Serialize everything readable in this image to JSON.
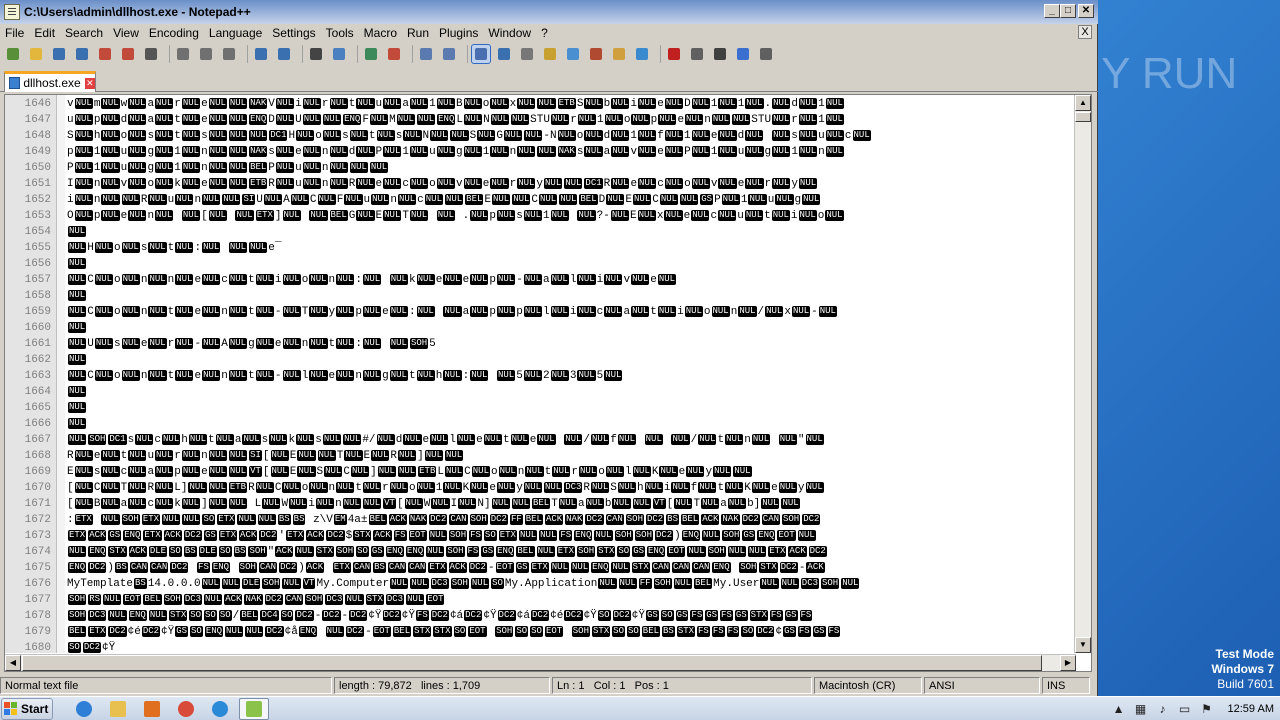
{
  "window": {
    "title": "C:\\Users\\admin\\dllhost.exe - Notepad++",
    "min_label": "_",
    "max_label": "□",
    "close_label": "✕"
  },
  "menu": [
    "File",
    "Edit",
    "Search",
    "View",
    "Encoding",
    "Language",
    "Settings",
    "Tools",
    "Macro",
    "Run",
    "Plugins",
    "Window",
    "?"
  ],
  "menu_close": "X",
  "toolbar_icons": [
    "new-file-icon",
    "open-file-icon",
    "save-icon",
    "save-all-icon",
    "close-icon",
    "close-all-icon",
    "print-icon",
    "cut-icon",
    "copy-icon",
    "paste-icon",
    "undo-icon",
    "redo-icon",
    "find-icon",
    "replace-icon",
    "zoom-in-icon",
    "zoom-out-icon",
    "sync-vertical-icon",
    "sync-horizontal-icon",
    "word-wrap-icon",
    "show-all-chars-icon",
    "indent-guide-icon",
    "user-language-icon",
    "doc-map-icon",
    "function-list-icon",
    "folder-workspace-icon",
    "monitoring-icon",
    "record-macro-icon",
    "stop-record-icon",
    "play-macro-icon",
    "run-macro-multiple-icon",
    "save-macro-icon"
  ],
  "tab": {
    "label": "dllhost.exe"
  },
  "editor": {
    "lines": [
      {
        "n": "1646",
        "t": "vNULmNULwNULaNULrNULeNULNULNAKVNULiNULrNULtNULuNULaNUL1NULBNULoNULxNULNULETBSNULbNULiNULeNULDNUL1NUL1NUL.NULdNUL1NUL"
      },
      {
        "n": "1647",
        "t": "uNULpNULdNULaNULtNULeNULNULENQDNULUNULNULENQFNULMNULNULENQLNULNNULNULSTUNULrNUL1NULoNULpNULeNULnNULNULSTUNULrNUL1NUL"
      },
      {
        "n": "1648",
        "t": "SNULhNULoNULsNULtNULsNULNULNULDC1HNULoNULsNULtNULsNULNNULNULSNULGNULNUL-NNULoNULdNUL1NULfNUL1NULeNULdNUL NULsNULuNULcNUL"
      },
      {
        "n": "1649",
        "t": "pNUL1NULuNULgNUL1NULnNULNULNAKsNULeNULnNULdNULPNUL1NULuNULgNUL1NULnNULNULNAKsNULaNULvNULeNULPNUL1NULuNULgNUL1NULnNUL"
      },
      {
        "n": "1650",
        "t": "PNUL1NULuNULgNUL1NULnNULNULBELPNULuNULnNULNULNUL"
      },
      {
        "n": "1651",
        "t": "INULnNULvNULoNULkNULeNULNULETBRNULuNULnNULRNULeNULcNULoNULvNULeNULrNULyNULNULDC1RNULeNULcNULoNULvNULeNULrNULyNUL"
      },
      {
        "n": "1652",
        "t": "iNULnNULNULRNULuNULnNULNULSIUNULANULCNULFNULuNULnNULcNULNULBELENULNULCNULNULBELDNULENULCNULNULGSPNUL1NULuNULgNUL"
      },
      {
        "n": "1653",
        "t": "ONULpNULeNULnNUL NUL[NUL NULETX]NUL NULBELGNULENULTNUL NUL    .NULpNULsNUL1NUL NUL?-NULENULxNULeNULcNULuNULtNULiNULoNUL"
      },
      {
        "n": "1654",
        "t": "NUL"
      },
      {
        "n": "1655",
        "t": "NULHNULoNULsNULtNUL:NUL NULNULe¯"
      },
      {
        "n": "1656",
        "t": "NUL"
      },
      {
        "n": "1657",
        "t": "NULCNULoNULnNULnNULeNULcNULtNULiNULoNULnNUL:NUL NULkNULeNULeNULpNUL-NULaNULlNULiNULvNULeNUL"
      },
      {
        "n": "1658",
        "t": "NUL"
      },
      {
        "n": "1659",
        "t": "NULCNULoNULnNULtNULeNULnNULtNUL-NULTNULyNULpNULeNUL:NUL NULaNULpNULpNULlNULiNULcNULaNULtNULiNULoNULnNUL/NULxNUL-NUL"
      },
      {
        "n": "1660",
        "t": "NUL"
      },
      {
        "n": "1661",
        "t": "NULUNULsNULeNULrNUL-NULANULgNULeNULnNULtNUL:NUL NULSOH5"
      },
      {
        "n": "1662",
        "t": "NUL"
      },
      {
        "n": "1663",
        "t": "NULCNULoNULnNULtNULeNULnNULtNUL-NULlNULeNULnNULgNULtNULhNUL:NUL NUL5NUL2NUL3NUL5NUL"
      },
      {
        "n": "1664",
        "t": "NUL"
      },
      {
        "n": "1665",
        "t": "NUL"
      },
      {
        "n": "1666",
        "t": "NUL"
      },
      {
        "n": "1667",
        "t": "NULSOHDC1sNULcNULhNULtNULaNULsNULkNULsNULNUL#/NULdNULeNULlNULeNULtNULeNUL NUL/NULfNUL NUL NUL/NULtNULnNUL NUL\"NUL"
      },
      {
        "n": "1668",
        "t": "RNULeNULtNULuNULrNULnNULNULSI[NULENULNULTNULENULRNUL]NULNUL"
      },
      {
        "n": "1669",
        "t": "ENULsNULcNULaNULpNULeNULNULVT[NULENULSNULCNUL]NULNULETBLNULCNULoNULnNULtNULrNULoNULlNULKNULeNULyNULNUL"
      },
      {
        "n": "1670",
        "t": "[NULCNULTNULRNULL]NULNULETBRNULCNULoNULnNULtNULrNULoNUL1NULKNULeNULyNULNULDC3RNULSNULhNULiNULfNULtNULKNULeNULyNUL"
      },
      {
        "n": "1671",
        "t": "[NULBNULaNULcNULkNUL]NULNUL  LNULWNULiNULnNULNULVT[NULWNULINULN]NULNULBELTNULaNULbNULNULVT[NULTNULaNULb]NULNUL"
      },
      {
        "n": "1672",
        "t": ":ETX NULSOHETXNULNULSOETXNULNULBSBS z\\VEM4a±BELACKNAKDC2CANSOHDC2FFBELACKNAKDC2CANSOHDC2BSBELACKNAKDC2CANSOHDC2"
      },
      {
        "n": "1673",
        "t": "ETXACKGSENQETXACKDC2GSETXACKDC2'ETXACKDC2$STXACKFSEOTNULSOHFSSOETXNULNULFSENQNULSOHSOHDC2)ENQNULSOHGSENQEOTNUL"
      },
      {
        "n": "1674",
        "t": "NULENQSTXACKDLESOBSDLESOBSSOH\"ACKNULSTXSOHSOGSENQENQNULSOHFSGSENQBELNULETXSOHSTXSOGSENQEOTNULSOHNULNULETXACKDC2"
      },
      {
        "n": "1675",
        "t": " ENQDC2)BSCANCANDC2 FSENQ SOHCANDC2)ACK ETXCANBSCANCANETXACKDC2-EOTGSETXNULNULENQNULSTXCANCANCANENQ SOHSTXDC2-ACK"
      },
      {
        "n": "1676",
        "t": "MyTemplateBS14.0.0.0NULNULDLESOHNULVTMy.ComputerNULNULDC3SOHNULSOMy.ApplicationNULNULFFSOHNULBELMy.UserNULNULDC3SOHNUL"
      },
      {
        "n": "1677",
        "t": "SOHRSNULEOTBELSOHDC3NULACKNAKDC2CANSOHDC3NULSTXDC3NULEOT"
      },
      {
        "n": "1678",
        "t": "SOHDC3NULENQNULSTXSOSOSO/BELDC4SODC2-DC2-DC2¢ŸDC2¢ŸFSDC2¢áDC2¢ŸDC2¢áDC2¢éDC2¢ŸSODC2¢ŸGSSOGSFSGSFSGSSTXFSGSFS"
      },
      {
        "n": "1679",
        "t": "BELETXDC2¢éDC2¢ŸGSSOENQNULNULDC2¢åENQ NULDC2-EOTBELSTXSTXSOEOT SOHSOSOEOT SOHSTXSOSOBELBSSTXFSFSFSSODC2¢GSFSGSFS"
      },
      {
        "n": "1680",
        "t": "SODC2¢Ÿ"
      }
    ]
  },
  "status": {
    "type": "Normal text file",
    "length": "length : 79,872",
    "lines": "lines : 1,709",
    "ln": "Ln : 1",
    "col": "Col : 1",
    "pos": "Pos : 1",
    "eol": "Macintosh (CR)",
    "encoding": "ANSI",
    "mode": "INS"
  },
  "taskbar": {
    "start_label": "Start",
    "clock": "12:59 AM",
    "tray_icons": [
      "show-hidden-icon",
      "network-icon",
      "volume-icon",
      "power-icon",
      "flag-icon"
    ],
    "pinned": [
      "ie-icon",
      "explorer-icon",
      "media-player-icon",
      "chrome-icon",
      "edge-icon",
      "notepadpp-icon"
    ]
  },
  "desktop": {
    "watermark": "ANY RUN",
    "os_line1": "Test Mode",
    "os_line2": "Windows 7",
    "os_line3": "Build 7601"
  }
}
